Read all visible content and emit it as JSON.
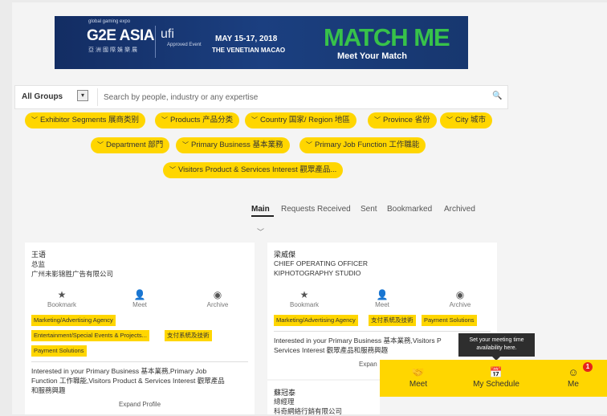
{
  "banner": {
    "tagline": "global gaming expo",
    "logo": "G2E ASIA",
    "logo_sub": "亞洲國際娛樂展",
    "ufi": "ufi",
    "ufi_approved": "Approved Event",
    "date": "MAY 15-17, 2018",
    "venue": "THE VENETIAN MACAO",
    "headline": "MATCH ME",
    "subline": "Meet Your Match"
  },
  "search": {
    "group_label": "All Groups",
    "placeholder": "Search by people, industry or any expertise",
    "dropdown_icon": "chevron-down-icon",
    "search_icon": "search-icon"
  },
  "filters": [
    "Exhibitor Segments 展商类别",
    "Products 产品分类",
    "Country 国家/ Region 地區",
    "Province 省份",
    "City 城市",
    "Department 部門",
    "Primary Business 基本業務",
    "Primary Job Function 工作職能",
    "Visitors Product & Services Interest 觀眾產品..."
  ],
  "tabs": [
    "Main",
    "Requests Received",
    "Sent",
    "Bookmarked",
    "Archived"
  ],
  "cards": [
    {
      "name": "王语",
      "title": "总监",
      "company": "广州未影锦胜广告有限公司",
      "actions": [
        "Bookmark",
        "Meet",
        "Archive"
      ],
      "tags": [
        "Marketing/Advertising Agency",
        "Entertainment/Special Events & Projects...",
        "支付系統及技術",
        "Payment Solutions"
      ],
      "interest_1": "Interested in your Primary Business 基本業務,Primary Job",
      "interest_2": "Function 工作職能,Visitors Product & Services Interest 觀眾產品",
      "interest_3": "和服務興趣",
      "expand": "Expand Profile"
    },
    {
      "name": "梁威傑",
      "title": "CHIEF OPERATING OFFICER",
      "company": "KIPHOTOGRAPHY STUDIO",
      "actions": [
        "Bookmark",
        "Meet",
        "Archive"
      ],
      "tags": [
        "Marketing/Advertising Agency",
        "支付系統及技術",
        "Payment Solutions"
      ],
      "interest_1": "Interested in your Primary Business 基本業務,Visitors P",
      "interest_2": "Services Interest 觀眾產品和服務興趣",
      "expand": "Expan"
    },
    {
      "name": "蘇冠泰",
      "title": "總經理",
      "company": "科奇網絡行銷有限公司"
    }
  ],
  "tooltip": {
    "line1": "Set your meeting time",
    "line2": "availability here."
  },
  "bottom_bar": {
    "items": [
      "Meet",
      "My Schedule",
      "Me"
    ],
    "badge": "1",
    "accent": "#ffd600"
  },
  "colors": {
    "chip": "#ffd600",
    "banner": "#1b3f80",
    "match": "#37c24a",
    "badge": "#e5231b"
  }
}
